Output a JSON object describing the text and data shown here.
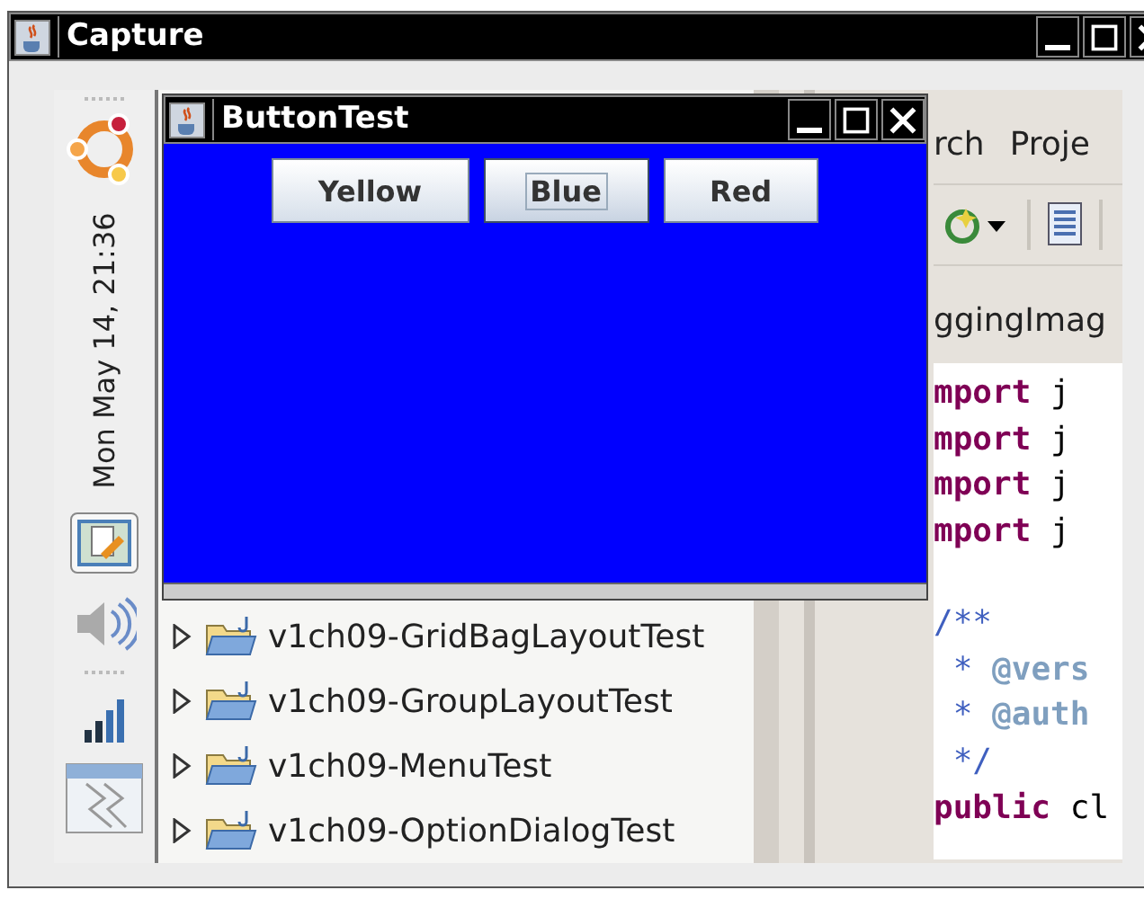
{
  "capture_window": {
    "title": "Capture"
  },
  "panel": {
    "clock": "Mon May 14, 21:36"
  },
  "eclipse": {
    "menu": [
      "rch",
      "Proje"
    ],
    "editor_tab": "ggingImag",
    "code_lines": [
      {
        "kind": "code",
        "segments": [
          {
            "kind": "keyword",
            "text": "mport"
          },
          {
            "kind": "plain",
            "text": " j"
          }
        ]
      },
      {
        "kind": "code",
        "segments": [
          {
            "kind": "keyword",
            "text": "mport"
          },
          {
            "kind": "plain",
            "text": " j"
          }
        ]
      },
      {
        "kind": "code",
        "segments": [
          {
            "kind": "keyword",
            "text": "mport"
          },
          {
            "kind": "plain",
            "text": " j"
          }
        ]
      },
      {
        "kind": "code",
        "segments": [
          {
            "kind": "keyword",
            "text": "mport"
          },
          {
            "kind": "plain",
            "text": " j"
          }
        ]
      },
      {
        "kind": "blank"
      },
      {
        "kind": "fold",
        "segments": [
          {
            "kind": "comment",
            "text": "/**"
          }
        ]
      },
      {
        "kind": "code",
        "segments": [
          {
            "kind": "comment",
            "text": " * "
          },
          {
            "kind": "tag",
            "text": "@vers"
          }
        ]
      },
      {
        "kind": "code",
        "segments": [
          {
            "kind": "comment",
            "text": " * "
          },
          {
            "kind": "tag",
            "text": "@auth"
          }
        ]
      },
      {
        "kind": "code",
        "segments": [
          {
            "kind": "comment",
            "text": " */"
          }
        ]
      },
      {
        "kind": "code",
        "segments": [
          {
            "kind": "keyword",
            "text": "public"
          },
          {
            "kind": "plain",
            "text": " cl"
          }
        ]
      }
    ],
    "tree": [
      {
        "label": "v1ch09-GridBagLayoutTest",
        "expanded": false
      },
      {
        "label": "v1ch09-GroupLayoutTest",
        "expanded": false
      },
      {
        "label": "v1ch09-MenuTest",
        "expanded": false
      },
      {
        "label": "v1ch09-OptionDialogTest",
        "expanded": false
      }
    ]
  },
  "button_test_window": {
    "title": "ButtonTest",
    "buttons": [
      {
        "label": "Yellow",
        "focused": false
      },
      {
        "label": "Blue",
        "focused": true
      },
      {
        "label": "Red",
        "focused": false
      }
    ]
  }
}
